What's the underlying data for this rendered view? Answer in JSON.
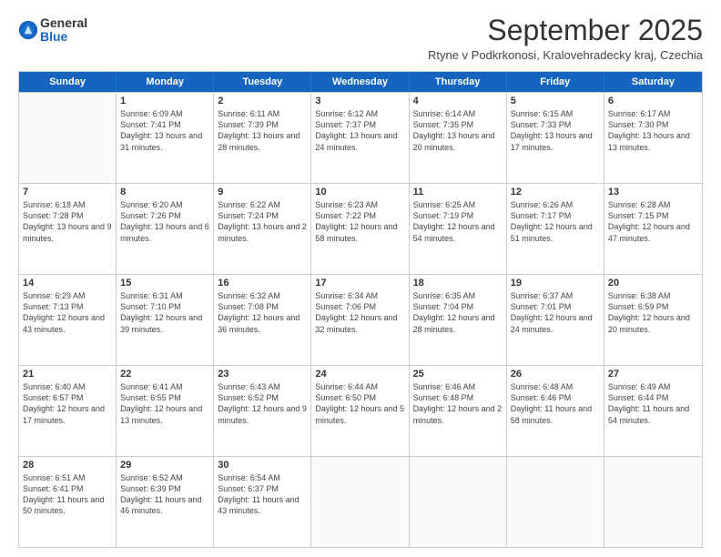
{
  "logo": {
    "general": "General",
    "blue": "Blue"
  },
  "title": "September 2025",
  "subtitle": "Rtyne v Podkrkonosi, Kralovehradecky kraj, Czechia",
  "header_days": [
    "Sunday",
    "Monday",
    "Tuesday",
    "Wednesday",
    "Thursday",
    "Friday",
    "Saturday"
  ],
  "weeks": [
    [
      {
        "day": "",
        "sunrise": "",
        "sunset": "",
        "daylight": ""
      },
      {
        "day": "1",
        "sunrise": "Sunrise: 6:09 AM",
        "sunset": "Sunset: 7:41 PM",
        "daylight": "Daylight: 13 hours and 31 minutes."
      },
      {
        "day": "2",
        "sunrise": "Sunrise: 6:11 AM",
        "sunset": "Sunset: 7:39 PM",
        "daylight": "Daylight: 13 hours and 28 minutes."
      },
      {
        "day": "3",
        "sunrise": "Sunrise: 6:12 AM",
        "sunset": "Sunset: 7:37 PM",
        "daylight": "Daylight: 13 hours and 24 minutes."
      },
      {
        "day": "4",
        "sunrise": "Sunrise: 6:14 AM",
        "sunset": "Sunset: 7:35 PM",
        "daylight": "Daylight: 13 hours and 20 minutes."
      },
      {
        "day": "5",
        "sunrise": "Sunrise: 6:15 AM",
        "sunset": "Sunset: 7:33 PM",
        "daylight": "Daylight: 13 hours and 17 minutes."
      },
      {
        "day": "6",
        "sunrise": "Sunrise: 6:17 AM",
        "sunset": "Sunset: 7:30 PM",
        "daylight": "Daylight: 13 hours and 13 minutes."
      }
    ],
    [
      {
        "day": "7",
        "sunrise": "Sunrise: 6:18 AM",
        "sunset": "Sunset: 7:28 PM",
        "daylight": "Daylight: 13 hours and 9 minutes."
      },
      {
        "day": "8",
        "sunrise": "Sunrise: 6:20 AM",
        "sunset": "Sunset: 7:26 PM",
        "daylight": "Daylight: 13 hours and 6 minutes."
      },
      {
        "day": "9",
        "sunrise": "Sunrise: 6:22 AM",
        "sunset": "Sunset: 7:24 PM",
        "daylight": "Daylight: 13 hours and 2 minutes."
      },
      {
        "day": "10",
        "sunrise": "Sunrise: 6:23 AM",
        "sunset": "Sunset: 7:22 PM",
        "daylight": "Daylight: 12 hours and 58 minutes."
      },
      {
        "day": "11",
        "sunrise": "Sunrise: 6:25 AM",
        "sunset": "Sunset: 7:19 PM",
        "daylight": "Daylight: 12 hours and 54 minutes."
      },
      {
        "day": "12",
        "sunrise": "Sunrise: 6:26 AM",
        "sunset": "Sunset: 7:17 PM",
        "daylight": "Daylight: 12 hours and 51 minutes."
      },
      {
        "day": "13",
        "sunrise": "Sunrise: 6:28 AM",
        "sunset": "Sunset: 7:15 PM",
        "daylight": "Daylight: 12 hours and 47 minutes."
      }
    ],
    [
      {
        "day": "14",
        "sunrise": "Sunrise: 6:29 AM",
        "sunset": "Sunset: 7:13 PM",
        "daylight": "Daylight: 12 hours and 43 minutes."
      },
      {
        "day": "15",
        "sunrise": "Sunrise: 6:31 AM",
        "sunset": "Sunset: 7:10 PM",
        "daylight": "Daylight: 12 hours and 39 minutes."
      },
      {
        "day": "16",
        "sunrise": "Sunrise: 6:32 AM",
        "sunset": "Sunset: 7:08 PM",
        "daylight": "Daylight: 12 hours and 36 minutes."
      },
      {
        "day": "17",
        "sunrise": "Sunrise: 6:34 AM",
        "sunset": "Sunset: 7:06 PM",
        "daylight": "Daylight: 12 hours and 32 minutes."
      },
      {
        "day": "18",
        "sunrise": "Sunrise: 6:35 AM",
        "sunset": "Sunset: 7:04 PM",
        "daylight": "Daylight: 12 hours and 28 minutes."
      },
      {
        "day": "19",
        "sunrise": "Sunrise: 6:37 AM",
        "sunset": "Sunset: 7:01 PM",
        "daylight": "Daylight: 12 hours and 24 minutes."
      },
      {
        "day": "20",
        "sunrise": "Sunrise: 6:38 AM",
        "sunset": "Sunset: 6:59 PM",
        "daylight": "Daylight: 12 hours and 20 minutes."
      }
    ],
    [
      {
        "day": "21",
        "sunrise": "Sunrise: 6:40 AM",
        "sunset": "Sunset: 6:57 PM",
        "daylight": "Daylight: 12 hours and 17 minutes."
      },
      {
        "day": "22",
        "sunrise": "Sunrise: 6:41 AM",
        "sunset": "Sunset: 6:55 PM",
        "daylight": "Daylight: 12 hours and 13 minutes."
      },
      {
        "day": "23",
        "sunrise": "Sunrise: 6:43 AM",
        "sunset": "Sunset: 6:52 PM",
        "daylight": "Daylight: 12 hours and 9 minutes."
      },
      {
        "day": "24",
        "sunrise": "Sunrise: 6:44 AM",
        "sunset": "Sunset: 6:50 PM",
        "daylight": "Daylight: 12 hours and 5 minutes."
      },
      {
        "day": "25",
        "sunrise": "Sunrise: 6:46 AM",
        "sunset": "Sunset: 6:48 PM",
        "daylight": "Daylight: 12 hours and 2 minutes."
      },
      {
        "day": "26",
        "sunrise": "Sunrise: 6:48 AM",
        "sunset": "Sunset: 6:46 PM",
        "daylight": "Daylight: 11 hours and 58 minutes."
      },
      {
        "day": "27",
        "sunrise": "Sunrise: 6:49 AM",
        "sunset": "Sunset: 6:44 PM",
        "daylight": "Daylight: 11 hours and 54 minutes."
      }
    ],
    [
      {
        "day": "28",
        "sunrise": "Sunrise: 6:51 AM",
        "sunset": "Sunset: 6:41 PM",
        "daylight": "Daylight: 11 hours and 50 minutes."
      },
      {
        "day": "29",
        "sunrise": "Sunrise: 6:52 AM",
        "sunset": "Sunset: 6:39 PM",
        "daylight": "Daylight: 11 hours and 46 minutes."
      },
      {
        "day": "30",
        "sunrise": "Sunrise: 6:54 AM",
        "sunset": "Sunset: 6:37 PM",
        "daylight": "Daylight: 11 hours and 43 minutes."
      },
      {
        "day": "",
        "sunrise": "",
        "sunset": "",
        "daylight": ""
      },
      {
        "day": "",
        "sunrise": "",
        "sunset": "",
        "daylight": ""
      },
      {
        "day": "",
        "sunrise": "",
        "sunset": "",
        "daylight": ""
      },
      {
        "day": "",
        "sunrise": "",
        "sunset": "",
        "daylight": ""
      }
    ]
  ]
}
